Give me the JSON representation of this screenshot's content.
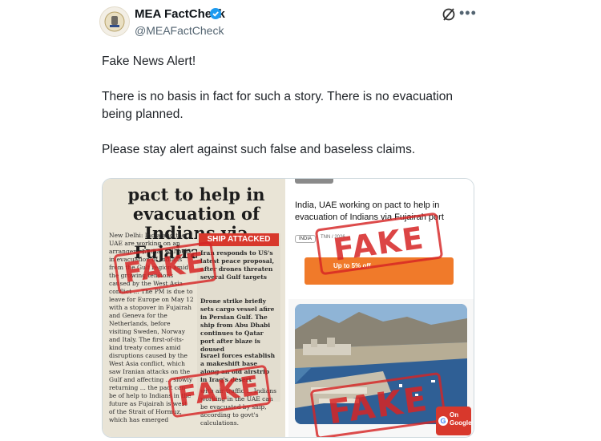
{
  "post": {
    "display_name": "MEA FactCheck",
    "handle": "@MEAFactCheck",
    "paragraphs": [
      "Fake News Alert!",
      "There is no basis in fact for such a story. There is no evacuation being planned.",
      "Please stay alert against such false and baseless claims."
    ]
  },
  "icons": {
    "verified": "verified-badge-icon",
    "grok": "grok-icon",
    "more": "more-options-icon"
  },
  "colors": {
    "verified_blue": "#1d9bf0",
    "stamp_red": "#d62424",
    "handle_gray": "#536471"
  },
  "media": {
    "left_newspaper": {
      "headline": "pact to help in evacuation of Indians via Fujairah port",
      "body_col1": "New Delhi: India and the UAE are working on an arrangement that will help in evacuation of Indians from the Gulf region amid the growing tensions caused by the West Asia conflict ... The PM is due to leave for Europe on May 12 with a stopover in Fujairah and Geneva for the Netherlands, before visiting Sweden, Norway and Italy. The first-of-its-kind treaty comes amid disruptions caused by the West Asia conflict, which saw Iranian attacks on the Gulf and affecting ... slowly returning ... the pact can be of help to Indians in the future as Fujairah is west of the Strait of Hormuz, which has emerged",
      "sidebar_title": "SHIP ATTACKED",
      "sidebar_items": [
        "Iran responds to US's latest peace proposal, after drones threaten several Gulf targets",
        "Drone strike briefly sets cargo vessel afire in Persian Gulf. The ship from Abu Dhabi continues to Qatar port after blaze is doused",
        "Israel forces establish a makeshift base along an old airstrip in Iraq's desert"
      ],
      "body_col2": "with air traffic ... Indians working in the UAE can be evacuated by ship, according to govt's calculations.",
      "stamp_top": "FAKE",
      "stamp_bottom": "FAKE"
    },
    "right_card": {
      "headline": "India, UAE working on pact to help in evacuation of Indians via Fujairah port",
      "tag": "INDIA",
      "meta": "TNN / 2026 ...",
      "ad_text": "Up to 5% off",
      "stamp_top": "FAKE",
      "stamp_bottom": "FAKE",
      "google_badge": "On Google",
      "google_letter": "G"
    }
  }
}
